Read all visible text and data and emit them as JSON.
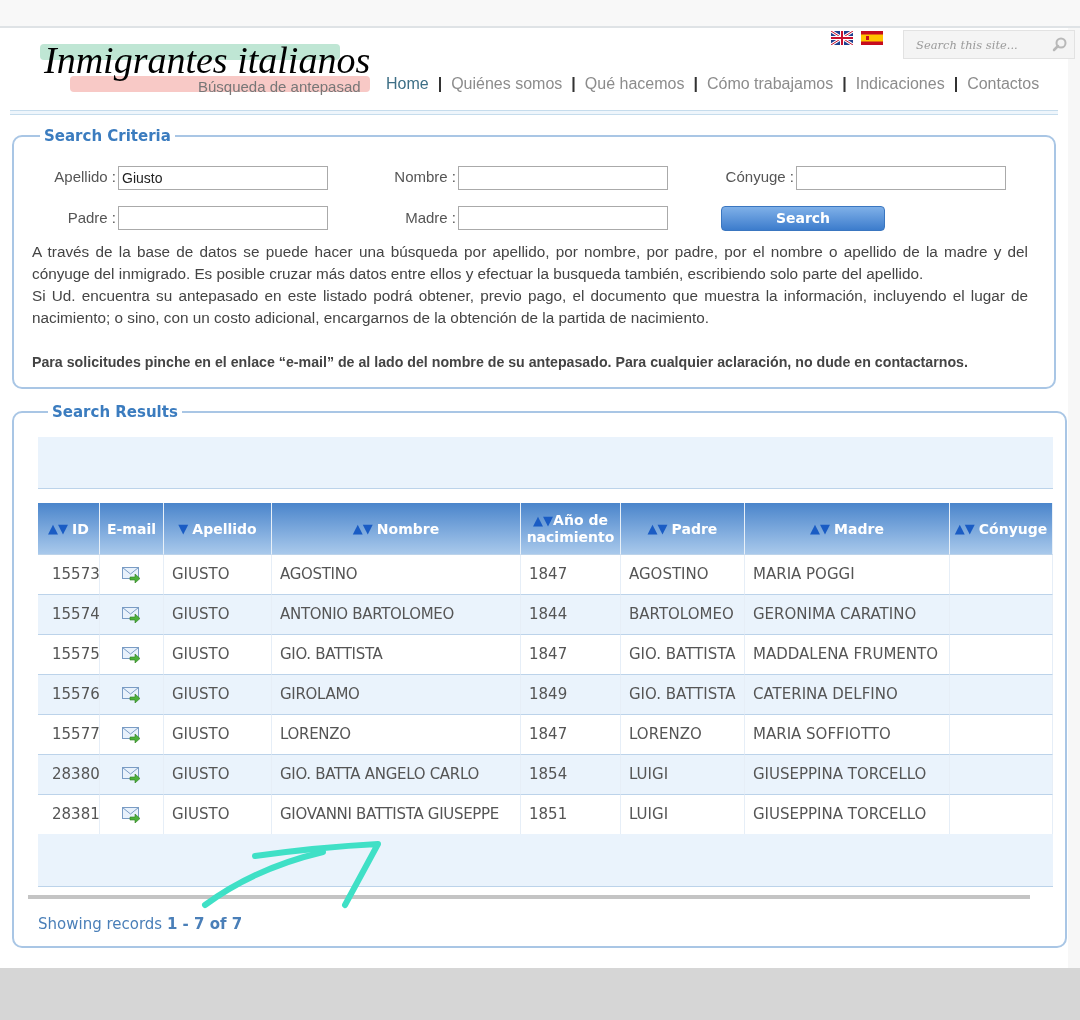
{
  "header": {
    "logo": {
      "title": "Inmigrantes italianos",
      "subtitle": "Búsqueda de antepasad"
    },
    "languages": [
      {
        "kind": "uk"
      },
      {
        "kind": "es"
      }
    ],
    "site_search": {
      "placeholder": "Search this site..."
    },
    "nav": [
      {
        "label": "Home",
        "selected": true
      },
      {
        "label": "Quiénes somos",
        "selected": false
      },
      {
        "label": "Qué hacemos",
        "selected": false
      },
      {
        "label": "Cómo trabajamos",
        "selected": false
      },
      {
        "label": "Indicaciones",
        "selected": false
      },
      {
        "label": "Contactos",
        "selected": false
      }
    ],
    "nav_separator": "|"
  },
  "search_criteria": {
    "legend": "Search Criteria",
    "fields": [
      {
        "label": "Apellido :",
        "value": "Giusto"
      },
      {
        "label": "Nombre :"
      },
      {
        "label": "Cónyuge :"
      },
      {
        "label": "Padre :"
      },
      {
        "label": "Madre :"
      }
    ],
    "button": "Search",
    "paragraphs": [
      "A través de la base de datos se puede hacer una búsqueda por apellido, por nombre, por padre, por el nombre o apellido de la madre y del cónyuge del inmigrado. Es posible cruzar más datos entre ellos y efectuar la busqueda también, escribiendo solo parte del apellido.",
      "Si Ud. encuentra su antepasado en este listado podrá obtener, previo pago, el documento que muestra la información, incluyendo el lugar de nacimiento; o sino, con un costo adicional, encargarnos de la obtención de la partida de nacimiento."
    ],
    "note": "Para solicitudes pinche en el enlace “e-mail” de al lado del nombre de su antepasado. Para cualquier aclaración, no dude en contactarnos."
  },
  "search_results": {
    "legend": "Search Results",
    "columns": [
      {
        "label": "ID",
        "sort": "▲▼"
      },
      {
        "label": "E-mail"
      },
      {
        "label": "Apellido",
        "sort": "▼"
      },
      {
        "label": "Nombre",
        "sort": "▲▼"
      },
      {
        "label": "Año de nacimiento",
        "sort": "▲▼"
      },
      {
        "label": "Padre",
        "sort": "▲▼"
      },
      {
        "label": "Madre",
        "sort": "▲▼"
      },
      {
        "label": "Cónyuge",
        "sort": "▲▼"
      }
    ],
    "rows": [
      {
        "id": "15573",
        "apellido": "GIUSTO",
        "nombre": "AGOSTINO",
        "ano": "1847",
        "padre": "AGOSTINO",
        "madre": "MARIA POGGI"
      },
      {
        "id": "15574",
        "apellido": "GIUSTO",
        "nombre": "ANTONIO BARTOLOMEO",
        "ano": "1844",
        "padre": "BARTOLOMEO",
        "madre": "GERONIMA CARATINO"
      },
      {
        "id": "15575",
        "apellido": "GIUSTO",
        "nombre": "GIO. BATTISTA",
        "ano": "1847",
        "padre": "GIO. BATTISTA",
        "madre": "MADDALENA FRUMENTO"
      },
      {
        "id": "15576",
        "apellido": "GIUSTO",
        "nombre": "GIROLAMO",
        "ano": "1849",
        "padre": "GIO. BATTISTA",
        "madre": "CATERINA DELFINO"
      },
      {
        "id": "15577",
        "apellido": "GIUSTO",
        "nombre": "LORENZO",
        "ano": "1847",
        "padre": "LORENZO",
        "madre": "MARIA SOFFIOTTO"
      },
      {
        "id": "28380",
        "apellido": "GIUSTO",
        "nombre": "GIO. BATTA ANGELO CARLO",
        "ano": "1854",
        "padre": "LUIGI",
        "madre": "GIUSEPPINA TORCELLO"
      },
      {
        "id": "28381",
        "apellido": "GIUSTO",
        "nombre": "GIOVANNI BATTISTA GIUSEPPE",
        "ano": "1851",
        "padre": "LUIGI",
        "madre": "GIUSEPPINA TORCELLO"
      }
    ],
    "footer": "Showing records **1 - 7 of 7**"
  }
}
